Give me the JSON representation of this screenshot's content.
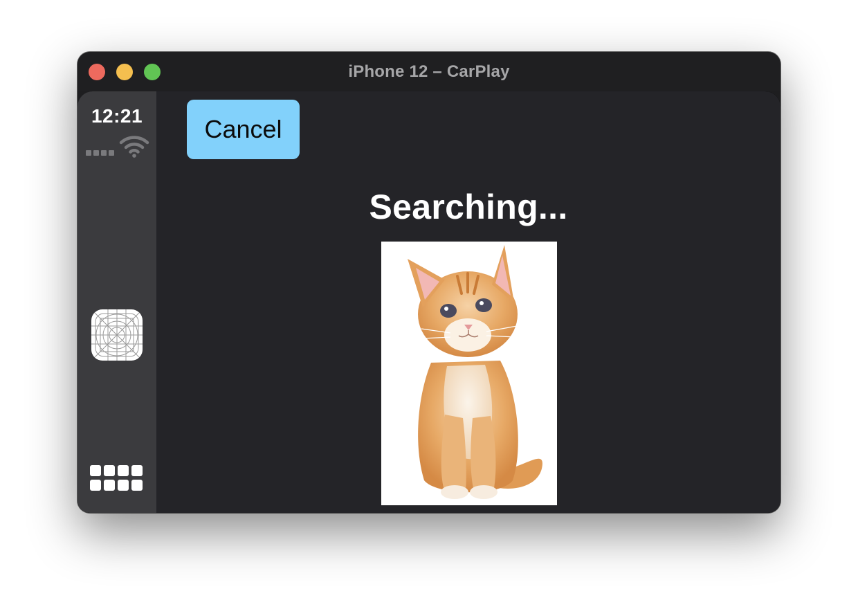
{
  "window": {
    "title": "iPhone 12 – CarPlay"
  },
  "status_bar": {
    "time": "12:21"
  },
  "sidebar": {
    "icons": [
      "app-icon-template",
      "app-grid-icon"
    ]
  },
  "main": {
    "cancel_label": "Cancel",
    "heading": "Searching...",
    "image_subject": "orange-kitten"
  },
  "colors": {
    "cancel_button": "#82d1fb",
    "content_background": "#242428",
    "sidebar_background": "#3b3b3e",
    "close": "#ed6a5e",
    "minimize": "#f5bf4f",
    "zoom": "#61c554"
  }
}
